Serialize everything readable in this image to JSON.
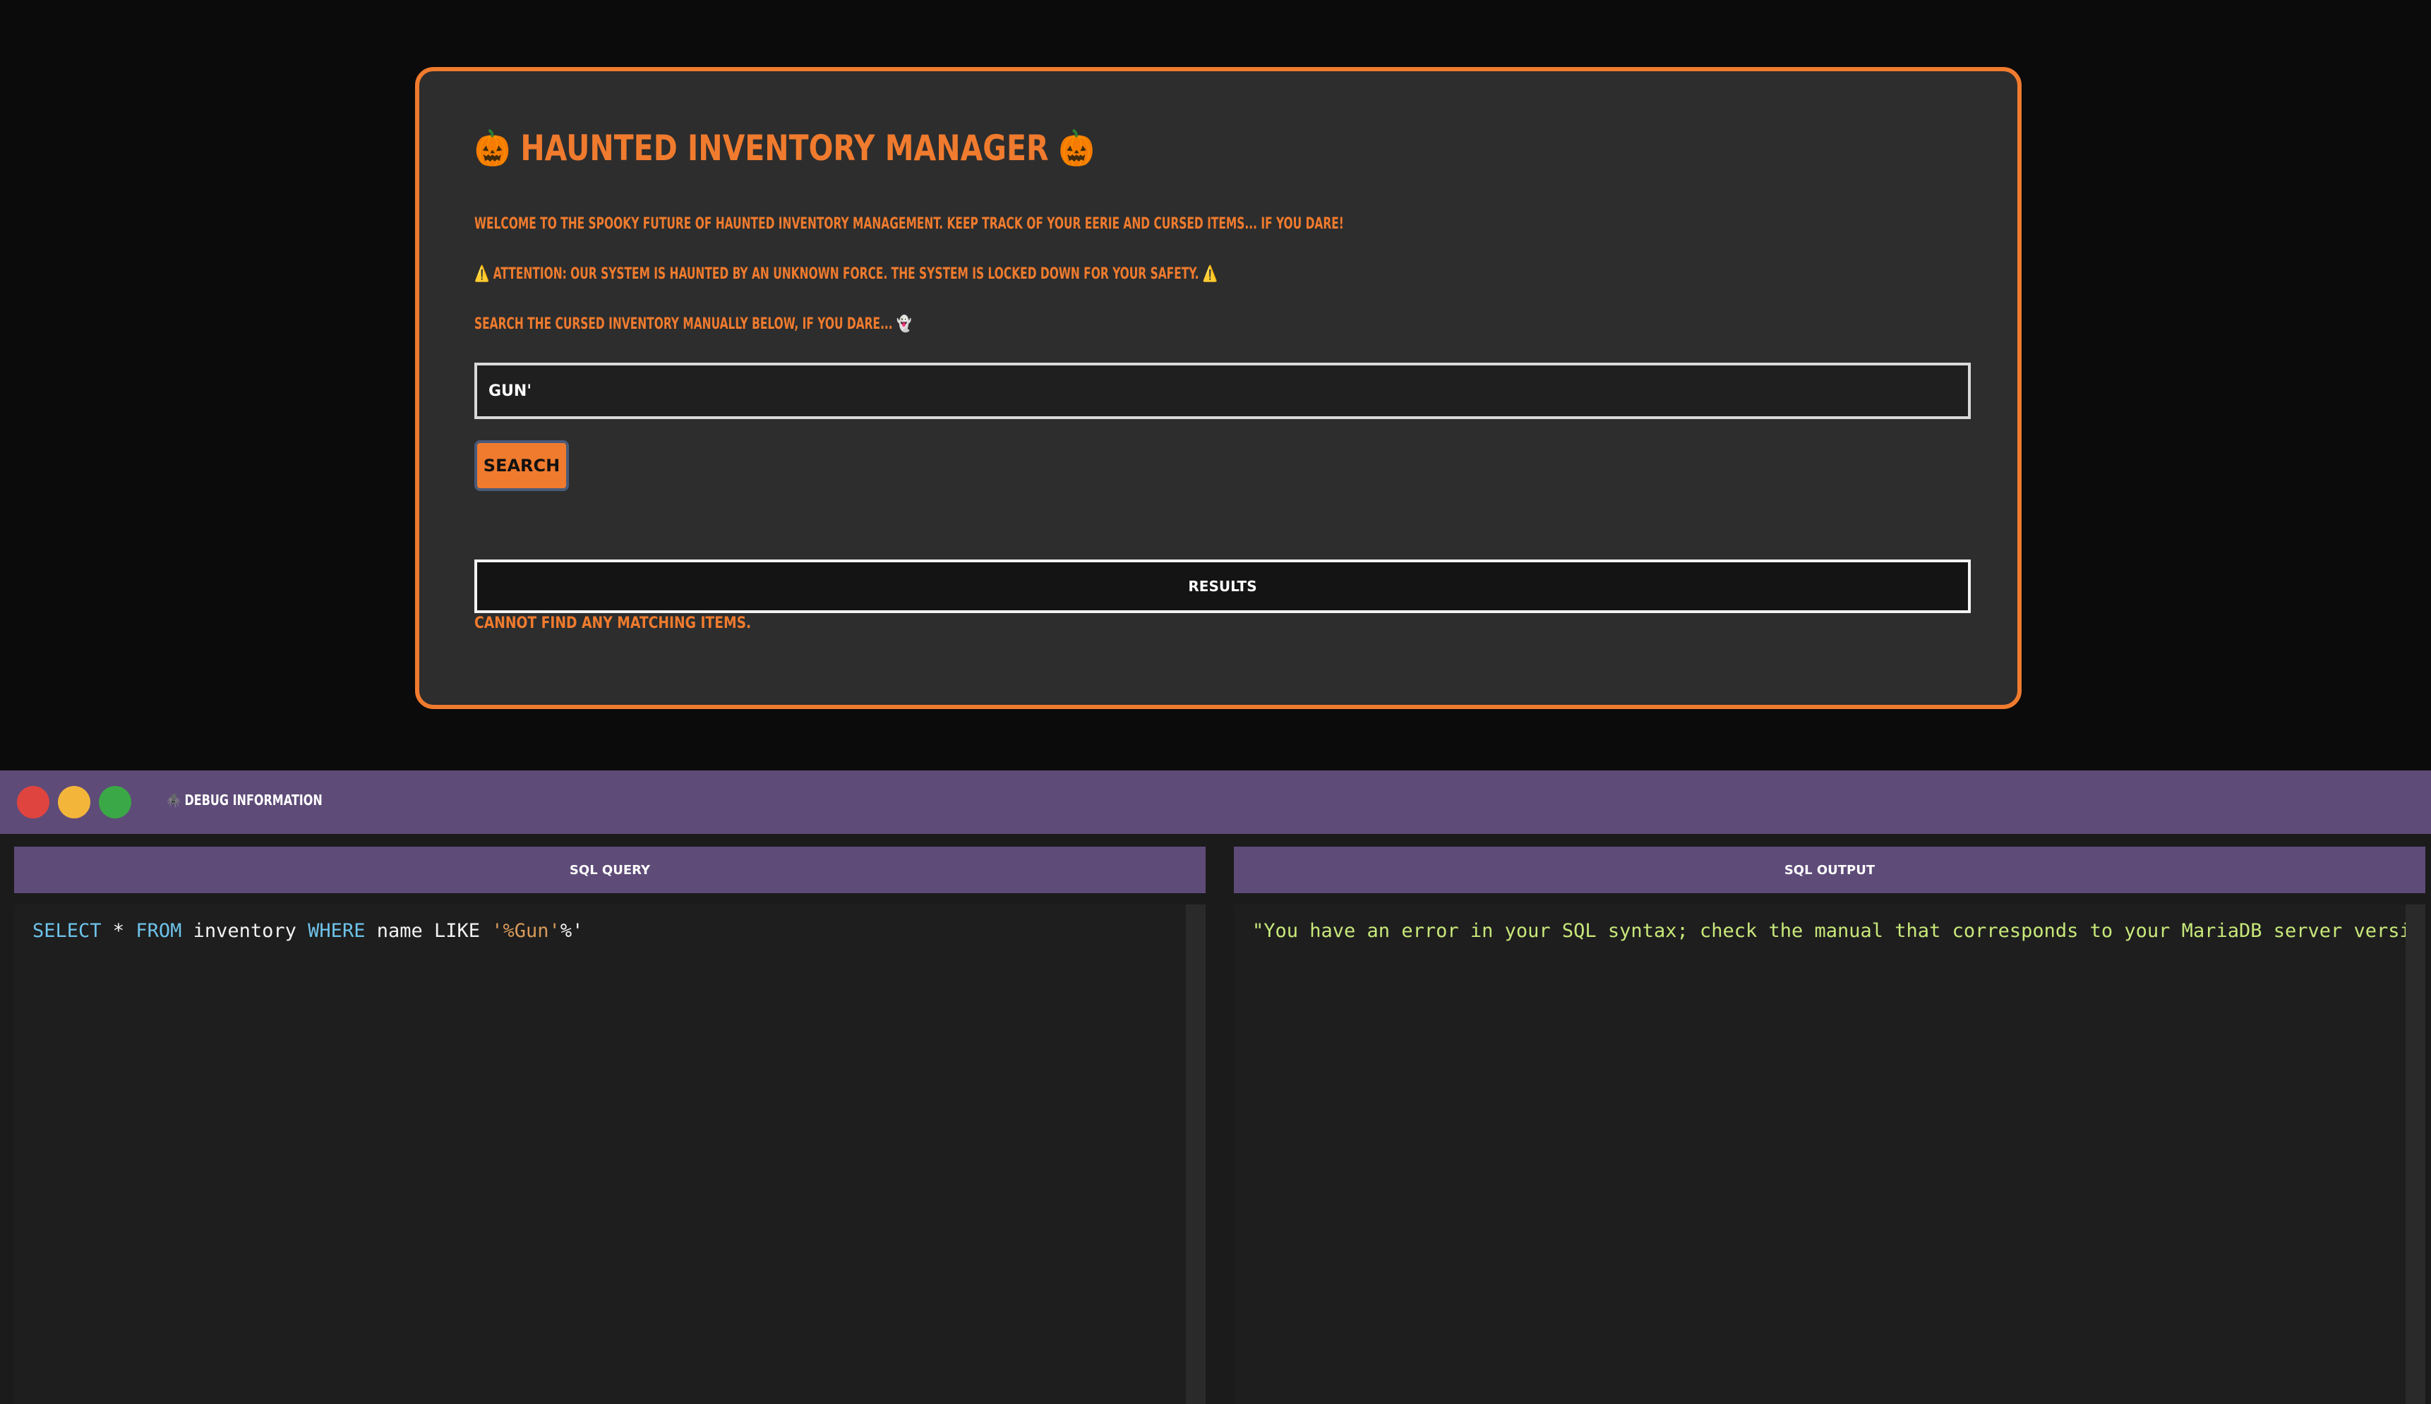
{
  "app": {
    "title": "🎃 HAUNTED INVENTORY MANAGER 🎃",
    "welcome": "Welcome to the spooky future of haunted inventory management. Keep track of your eerie and cursed items... if you dare!",
    "attention_icon": "⚠️",
    "attention_text": "Attention: Our system is haunted by an unknown force. The system is locked down for your safety.",
    "search_hint": "Search the cursed inventory manually below, if you dare... 👻",
    "search": {
      "value": "Gun'",
      "placeholder": ""
    },
    "search_button": "Search",
    "results_header": "Results",
    "no_results": "Cannot find any matching items."
  },
  "debug": {
    "title": "🕷️ Debug Information",
    "query_header": "SQL Query",
    "output_header": "SQL Output",
    "query_tokens": [
      {
        "text": "SELECT",
        "kind": "kw"
      },
      {
        "text": " * ",
        "kind": "plain"
      },
      {
        "text": "FROM",
        "kind": "kw"
      },
      {
        "text": " inventory ",
        "kind": "plain"
      },
      {
        "text": "WHERE",
        "kind": "kw"
      },
      {
        "text": " name LIKE ",
        "kind": "plain"
      },
      {
        "text": "'%Gun'",
        "kind": "str"
      },
      {
        "text": "%'",
        "kind": "plain"
      }
    ],
    "output_text": "\"You have an error in your SQL syntax; check the manual that corresponds to your MariaDB server version f",
    "window_buttons": [
      "close",
      "minimize",
      "maximize"
    ]
  },
  "colors": {
    "accent": "#f07b2e",
    "card_bg": "#2d2d2d",
    "debug_bar": "#5e4b78",
    "sql_keyword": "#6ec3ea",
    "sql_output": "#c8e87a"
  }
}
